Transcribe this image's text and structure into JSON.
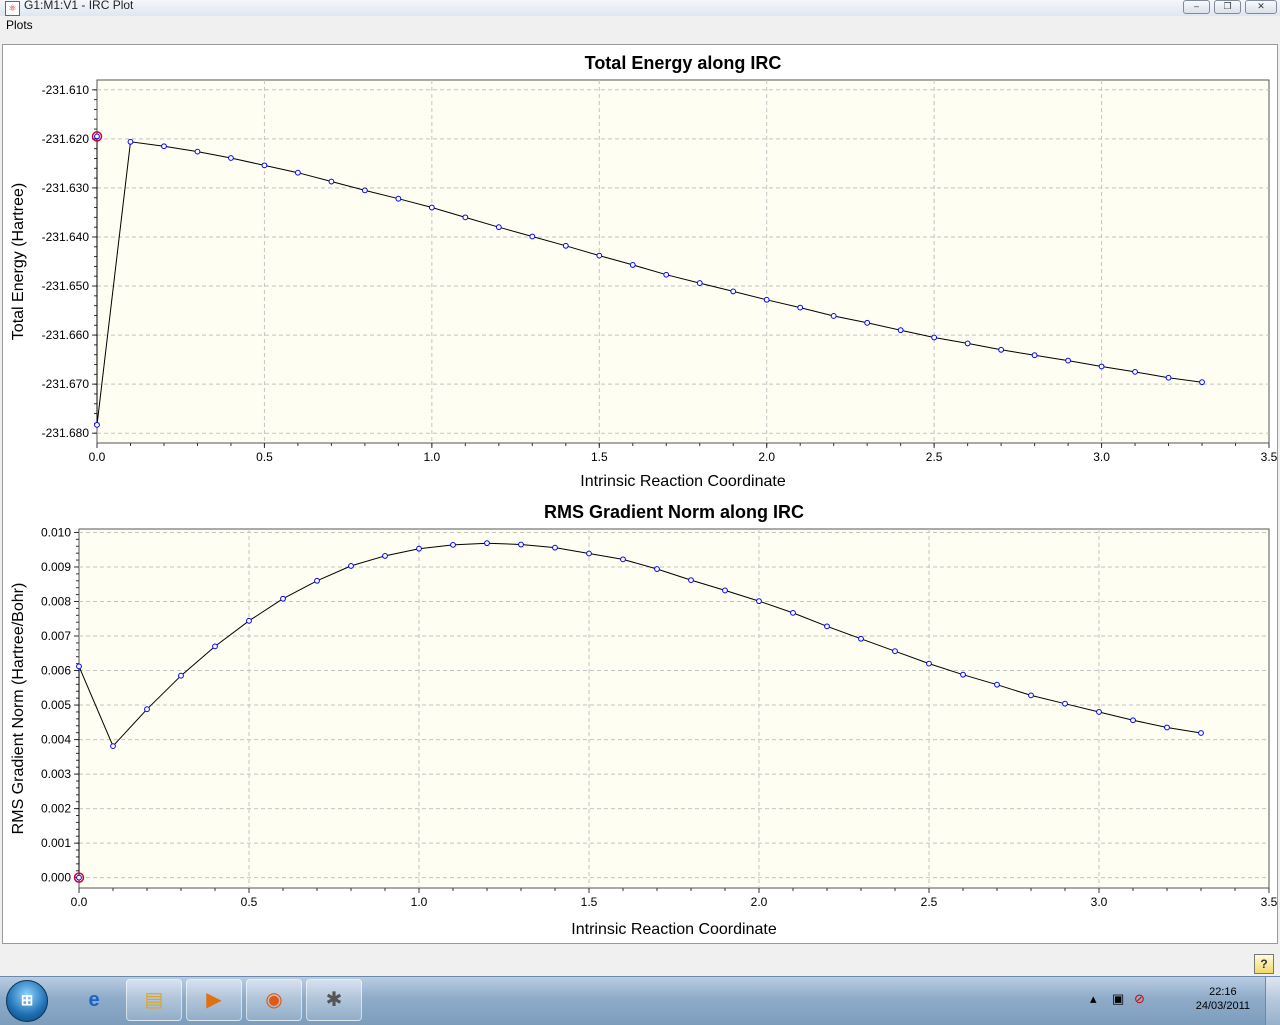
{
  "window": {
    "title": "G1:M1:V1 - IRC Plot",
    "icon": "irc-plot-app-icon",
    "controls": [
      "minimize-icon",
      "restore-icon",
      "close-icon"
    ]
  },
  "menu": {
    "plots_label": "Plots"
  },
  "chart_data": [
    {
      "type": "line",
      "title": "Total Energy along IRC",
      "xlabel": "Intrinsic Reaction Coordinate",
      "ylabel": "Total Energy (Hartree)",
      "xlim": [
        0,
        3.5
      ],
      "ylim": [
        -231.682,
        -231.608
      ],
      "xticks": [
        "0.0",
        "0.5",
        "1.0",
        "1.5",
        "2.0",
        "2.5",
        "3.0",
        "3.5"
      ],
      "yticks": [
        "-231.610",
        "-231.620",
        "-231.630",
        "-231.640",
        "-231.650",
        "-231.660",
        "-231.670",
        "-231.680"
      ],
      "grid": true,
      "highlight_point": {
        "x": 0.0,
        "y": -231.6195
      },
      "x": [
        0.0,
        0.0,
        0.1,
        0.2,
        0.3,
        0.4,
        0.5,
        0.6,
        0.7,
        0.8,
        0.9,
        1.0,
        1.1,
        1.2,
        1.3,
        1.4,
        1.5,
        1.6,
        1.7,
        1.8,
        1.9,
        2.0,
        2.1,
        2.2,
        2.3,
        2.4,
        2.5,
        2.6,
        2.7,
        2.8,
        2.9,
        3.0,
        3.1,
        3.2,
        3.3
      ],
      "y": [
        -231.6195,
        -231.6783,
        -231.6206,
        -231.6215,
        -231.6226,
        -231.6239,
        -231.6254,
        -231.6269,
        -231.6287,
        -231.6305,
        -231.6322,
        -231.634,
        -231.636,
        -231.638,
        -231.6399,
        -231.6418,
        -231.6438,
        -231.6457,
        -231.6477,
        -231.6494,
        -231.6511,
        -231.6528,
        -231.6544,
        -231.6561,
        -231.6575,
        -231.659,
        -231.6605,
        -231.6617,
        -231.663,
        -231.6641,
        -231.6652,
        -231.6664,
        -231.6675,
        -231.6687,
        -231.6696
      ]
    },
    {
      "type": "line",
      "title": "RMS Gradient Norm along IRC",
      "xlabel": "Intrinsic Reaction Coordinate",
      "ylabel": "RMS Gradient Norm (Hartree/Bohr)",
      "xlim": [
        0,
        3.5
      ],
      "ylim": [
        -0.0003,
        0.0101
      ],
      "xticks": [
        "0.0",
        "0.5",
        "1.0",
        "1.5",
        "2.0",
        "2.5",
        "3.0",
        "3.5"
      ],
      "yticks": [
        "0.000",
        "0.001",
        "0.002",
        "0.003",
        "0.004",
        "0.005",
        "0.006",
        "0.007",
        "0.008",
        "0.009",
        "0.010"
      ],
      "grid": true,
      "highlight_point": {
        "x": 0.0,
        "y": 0.0
      },
      "x": [
        0.0,
        0.0,
        0.1,
        0.2,
        0.3,
        0.4,
        0.5,
        0.6,
        0.7,
        0.8,
        0.9,
        1.0,
        1.1,
        1.2,
        1.3,
        1.4,
        1.5,
        1.6,
        1.7,
        1.8,
        1.9,
        2.0,
        2.1,
        2.2,
        2.3,
        2.4,
        2.5,
        2.6,
        2.7,
        2.8,
        2.9,
        3.0,
        3.1,
        3.2,
        3.3
      ],
      "y": [
        0.0,
        0.00612,
        0.00381,
        0.00488,
        0.00585,
        0.0067,
        0.00744,
        0.00808,
        0.0086,
        0.00903,
        0.00932,
        0.00953,
        0.00964,
        0.00969,
        0.00965,
        0.00956,
        0.00939,
        0.00922,
        0.00894,
        0.00862,
        0.00832,
        0.00801,
        0.00767,
        0.00728,
        0.00692,
        0.00656,
        0.0062,
        0.00588,
        0.00559,
        0.00528,
        0.00504,
        0.0048,
        0.00456,
        0.00435,
        0.00419
      ]
    }
  ],
  "statusbar": {
    "help_label": "?"
  },
  "taskbar": {
    "apps": [
      "internet-explorer-icon",
      "windows-explorer-icon",
      "media-player-icon",
      "firefox-icon",
      "gaussview-icon"
    ],
    "clock_time": "22:16",
    "clock_date": "24/03/2011"
  },
  "colors": {
    "plot_bg": "#fefef2",
    "line": "#000000",
    "marker": "#0000ff",
    "highlight": "#cc0033",
    "grid": "#c4c4c4"
  }
}
